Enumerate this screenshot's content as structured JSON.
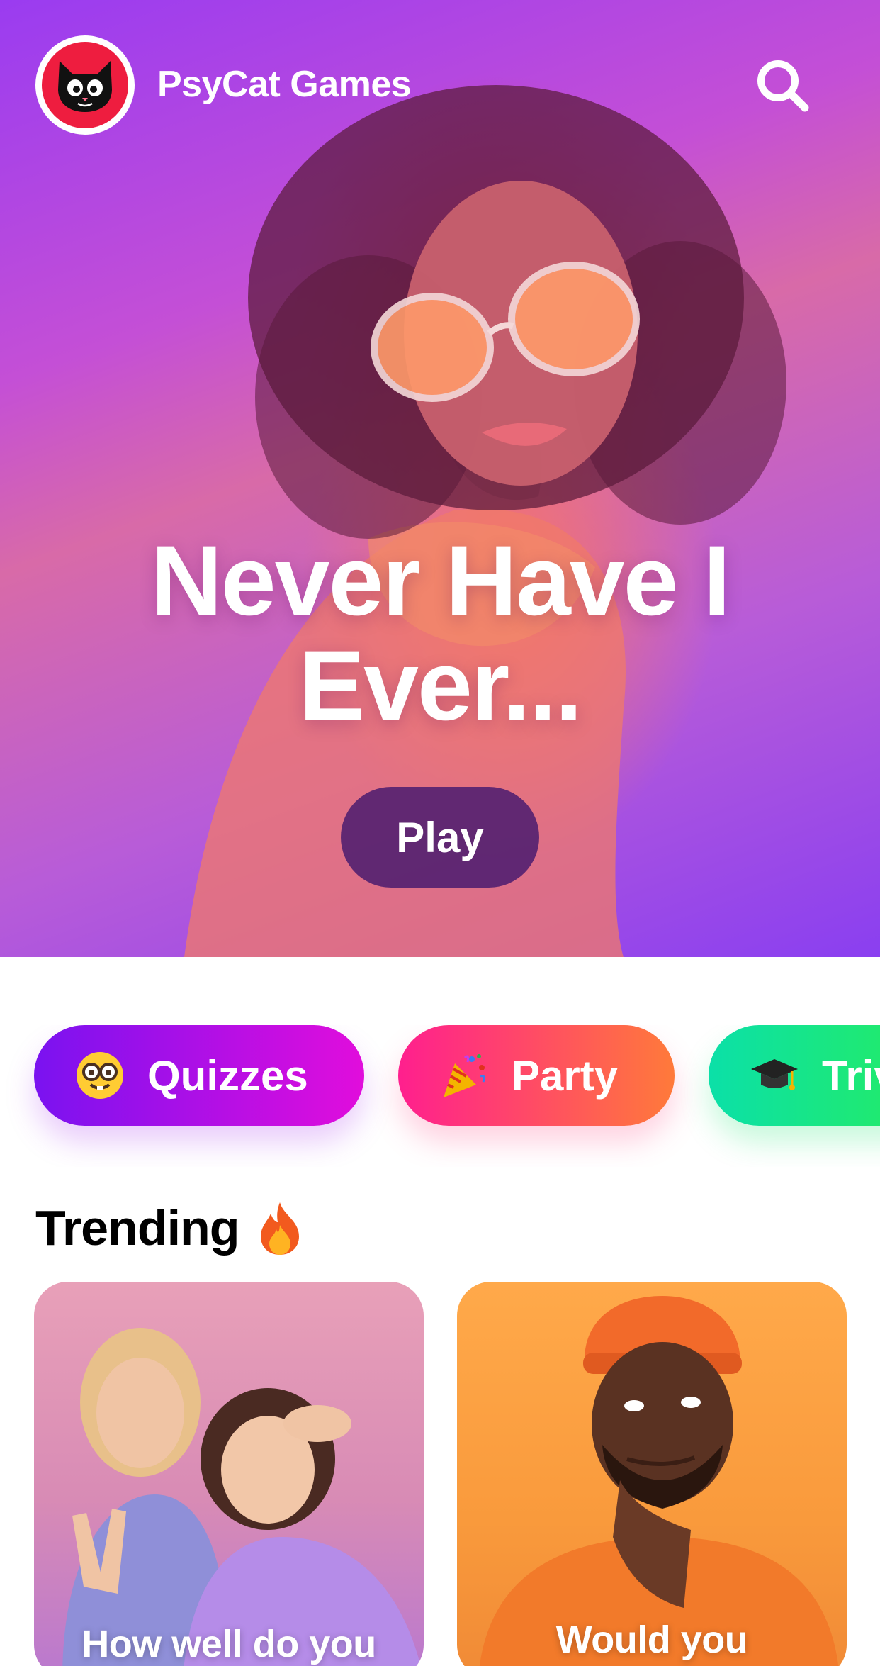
{
  "app": {
    "brand_name": "PsyCat Games",
    "logo_icon": "cat-face-icon",
    "search_icon": "search-icon"
  },
  "hero": {
    "title": "Never Have I Ever...",
    "play_label": "Play"
  },
  "categories": [
    {
      "label": "Quizzes",
      "icon": "nerd-face-emoji"
    },
    {
      "label": "Party",
      "icon": "party-popper-emoji"
    },
    {
      "label": "Trivia",
      "icon": "graduation-cap-emoji"
    }
  ],
  "trending": {
    "title": "Trending",
    "title_icon": "fire-emoji",
    "cards": [
      {
        "title": "How well do you"
      },
      {
        "title": "Would you"
      }
    ]
  },
  "colors": {
    "accent_purple": "#7a12f0",
    "accent_pink": "#ff1f8e",
    "accent_green": "#2ef04a",
    "logo_red": "#ee1d3f",
    "play_button": "#4e1e70"
  }
}
